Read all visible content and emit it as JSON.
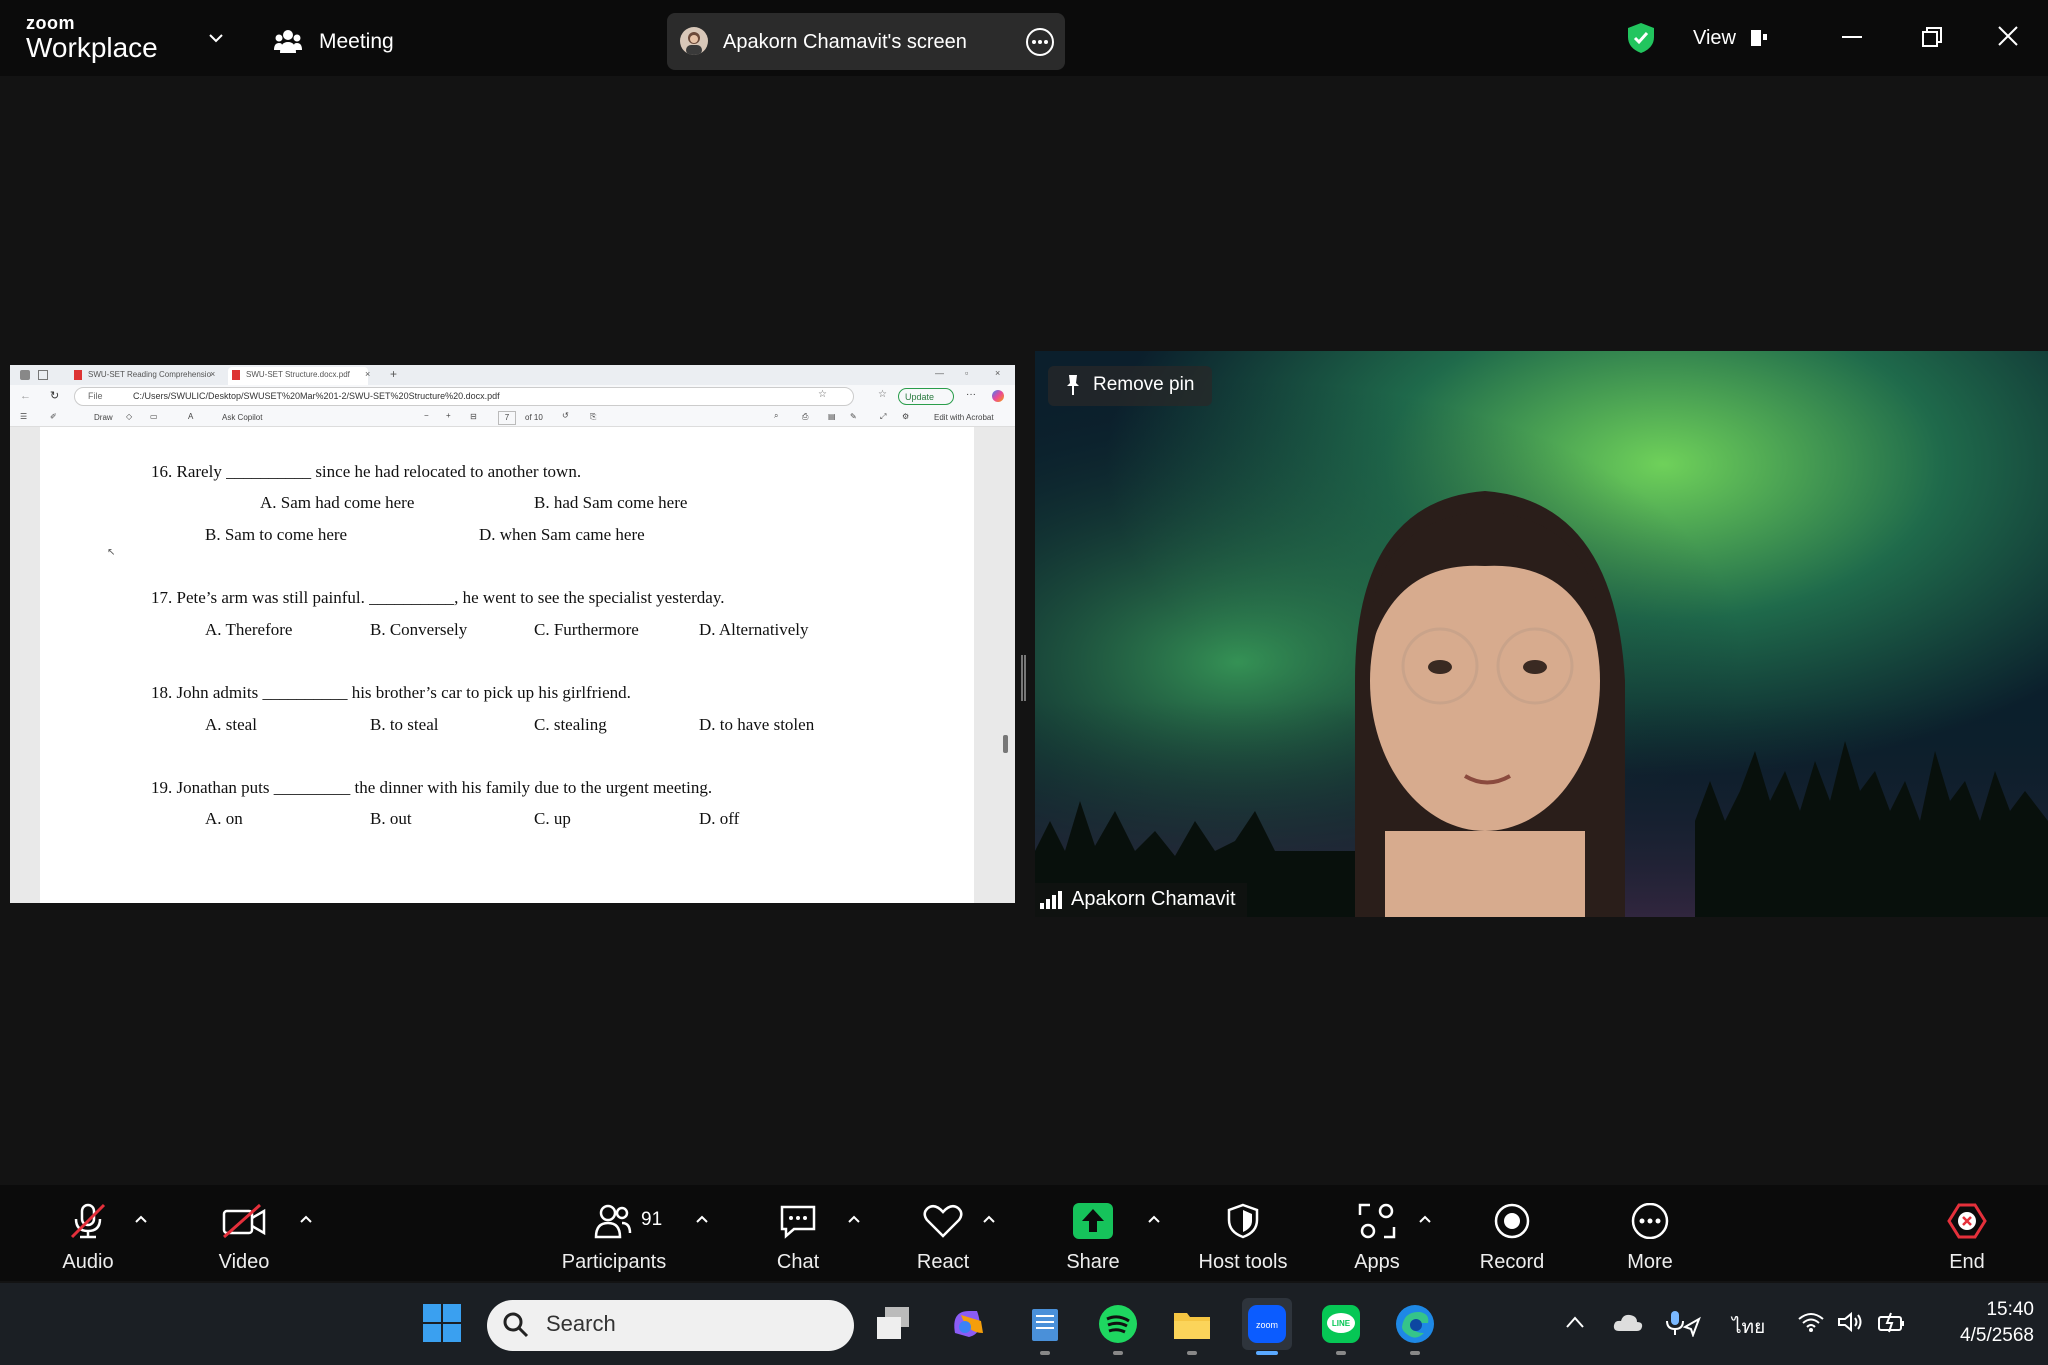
{
  "app": {
    "brand_small": "zoom",
    "brand_large": "Workplace",
    "meeting_label": "Meeting",
    "view_label": "View"
  },
  "screen_share": {
    "title": "Apakorn Chamavit's screen"
  },
  "browser": {
    "tab1": "SWU-SET Reading Comprehensio",
    "tab2": "SWU-SET Structure.docx.pdf",
    "address": "C:/Users/SWULIC/Desktop/SWUSET%20Mar%201-2/SWU-SET%20Structure%20.docx.pdf",
    "file_label": "File",
    "update_label": "Update",
    "toolbar": {
      "draw": "Draw",
      "copilot": "Ask Copilot",
      "page": "7",
      "of_pages": "of 10",
      "edit": "Edit with Acrobat"
    }
  },
  "document": {
    "questions": [
      {
        "stem": "16. Rarely __________ since he had relocated to another town.",
        "options": [
          "A. Sam had come here",
          "B. had Sam come here",
          "B. Sam to come here",
          "D. when Sam came here"
        ]
      },
      {
        "stem": "17. Pete’s arm was still painful. __________, he went to see the specialist yesterday.",
        "options": [
          "A. Therefore",
          "B. Conversely",
          "C. Furthermore",
          "D. Alternatively"
        ]
      },
      {
        "stem": "18. John admits __________ his brother’s car to pick up his girlfriend.",
        "options": [
          "A. steal",
          "B. to steal",
          "C. stealing",
          "D. to have stolen"
        ]
      },
      {
        "stem": "19. Jonathan puts _________ the dinner with his family due to the urgent meeting.",
        "options": [
          "A. on",
          "B. out",
          "C. up",
          "D. off"
        ]
      }
    ]
  },
  "video": {
    "pin_label": "Remove pin",
    "participant_name": "Apakorn Chamavit"
  },
  "toolbar": {
    "audio": "Audio",
    "video": "Video",
    "participants": "Participants",
    "participant_count": "91",
    "chat": "Chat",
    "react": "React",
    "share": "Share",
    "host_tools": "Host tools",
    "apps": "Apps",
    "record": "Record",
    "more": "More",
    "end": "End"
  },
  "taskbar": {
    "search_placeholder": "Search",
    "language": "ไทย",
    "time": "15:40",
    "date": "4/5/2568"
  },
  "colors": {
    "share_green": "#16c35b",
    "end_red": "#e5303b",
    "shield_green": "#22c55e"
  }
}
